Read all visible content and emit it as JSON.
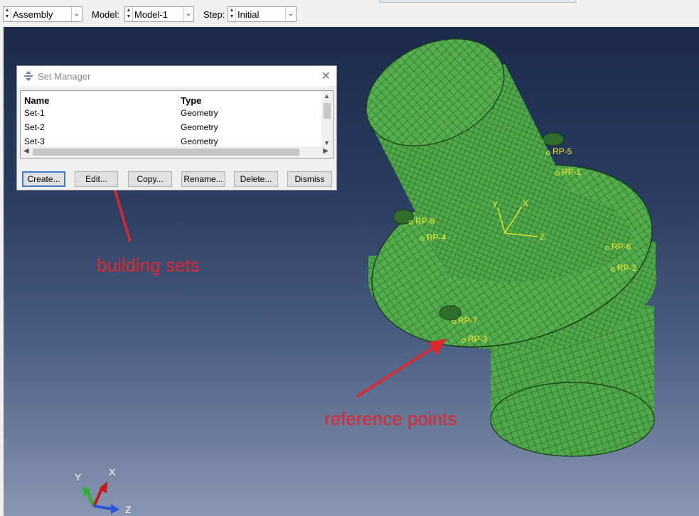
{
  "toolbar": {
    "module": "Assembly",
    "model_label": "Model:",
    "model": "Model-1",
    "step_label": "Step:",
    "step": "Initial"
  },
  "set_manager": {
    "title": "Set Manager",
    "columns": [
      "Name",
      "Type"
    ],
    "rows": [
      {
        "name": "Set-1",
        "type": "Geometry"
      },
      {
        "name": "Set-2",
        "type": "Geometry"
      },
      {
        "name": "Set-3",
        "type": "Geometry"
      }
    ],
    "buttons": [
      "Create...",
      "Edit...",
      "Copy...",
      "Rename...",
      "Delete...",
      "Dismiss"
    ]
  },
  "annotations": {
    "sets": "building sets",
    "points": "reference points"
  },
  "part_triad": {
    "x": "X",
    "y": "Y",
    "z": "Z"
  },
  "reference_points": [
    "RP-1",
    "RP-2",
    "RP-3",
    "RP-4",
    "RP-5",
    "RP-6",
    "RP-7",
    "RP-8"
  ],
  "global_triad": {
    "x": "X",
    "y": "Y",
    "z": "Z"
  },
  "colors": {
    "mesh_fill": "#4fa84a",
    "mesh_lines": "#163a14",
    "rp_label": "#f4ef2a",
    "annotation": "#e1262c"
  }
}
